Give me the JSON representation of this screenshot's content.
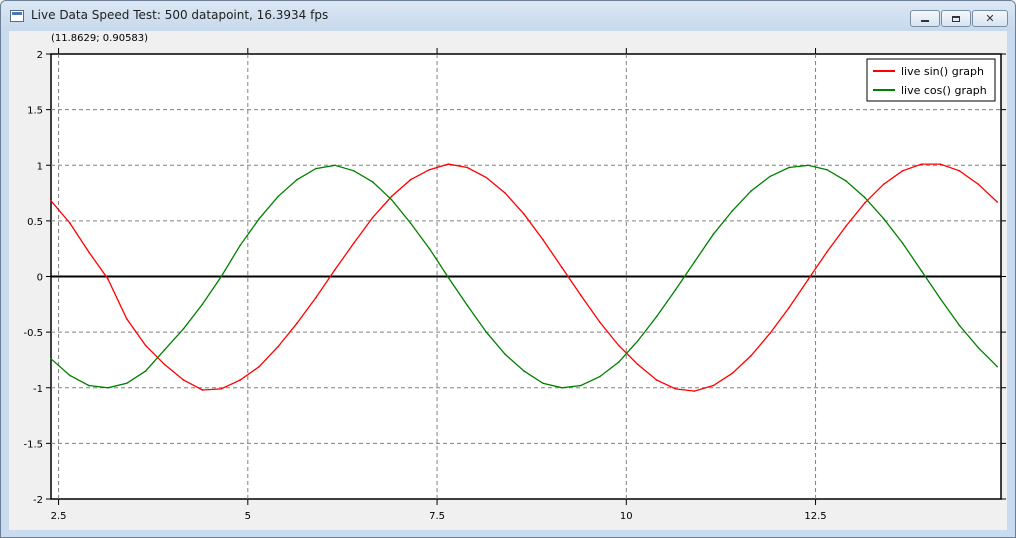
{
  "window": {
    "title": "Live Data Speed Test: 500 datapoint, 16.3934 fps"
  },
  "coord_readout": "(11.8629; 0.90583)",
  "colors": {
    "sin": "#ff0000",
    "cos": "#008000",
    "grid": "#808080",
    "zero_line": "#000000"
  },
  "chart_data": {
    "type": "line",
    "title": "",
    "xlabel": "",
    "ylabel": "",
    "xlim": [
      2.4,
      14.95
    ],
    "ylim": [
      -2,
      2
    ],
    "x_ticks": [
      2.5,
      5,
      7.5,
      10,
      12.5
    ],
    "x_tick_labels": [
      "2.5",
      "5",
      "7.5",
      "10",
      "12.5"
    ],
    "y_ticks": [
      -2,
      -1.5,
      -1,
      -0.5,
      0,
      0.5,
      1,
      1.5,
      2
    ],
    "y_tick_labels": [
      "-2",
      "-1.5",
      "-1",
      "-0.5",
      "0",
      "0.5",
      "1",
      "1.5",
      "2"
    ],
    "grid": true,
    "legend_position": "top-right",
    "x": [
      2.4,
      2.65,
      2.9,
      3.15,
      3.4,
      3.65,
      3.9,
      4.15,
      4.4,
      4.65,
      4.9,
      5.15,
      5.4,
      5.65,
      5.9,
      6.15,
      6.4,
      6.65,
      6.9,
      7.15,
      7.4,
      7.65,
      7.9,
      8.15,
      8.4,
      8.65,
      8.9,
      9.15,
      9.4,
      9.65,
      9.9,
      10.15,
      10.4,
      10.65,
      10.9,
      11.15,
      11.4,
      11.65,
      11.9,
      12.15,
      12.4,
      12.65,
      12.9,
      13.15,
      13.4,
      13.65,
      13.9,
      14.15,
      14.4,
      14.65,
      14.9
    ],
    "series": [
      {
        "name": "live sin() graph",
        "color": "#ff0000",
        "values": [
          0.68,
          0.48,
          0.22,
          -0.02,
          -0.38,
          -0.62,
          -0.79,
          -0.93,
          -1.02,
          -1.01,
          -0.93,
          -0.81,
          -0.63,
          -0.42,
          -0.19,
          0.06,
          0.3,
          0.53,
          0.72,
          0.87,
          0.96,
          1.01,
          0.98,
          0.89,
          0.75,
          0.56,
          0.33,
          0.08,
          -0.17,
          -0.41,
          -0.62,
          -0.79,
          -0.93,
          -1.01,
          -1.03,
          -0.98,
          -0.87,
          -0.71,
          -0.51,
          -0.28,
          -0.03,
          0.22,
          0.45,
          0.66,
          0.83,
          0.95,
          1.01,
          1.01,
          0.95,
          0.83,
          0.67
        ]
      },
      {
        "name": "live cos() graph",
        "color": "#008000",
        "values": [
          -0.74,
          -0.89,
          -0.98,
          -1.0,
          -0.96,
          -0.85,
          -0.66,
          -0.47,
          -0.25,
          0.0,
          0.28,
          0.52,
          0.72,
          0.87,
          0.97,
          1.0,
          0.95,
          0.85,
          0.69,
          0.48,
          0.25,
          -0.01,
          -0.26,
          -0.5,
          -0.7,
          -0.85,
          -0.96,
          -1.0,
          -0.98,
          -0.9,
          -0.77,
          -0.58,
          -0.36,
          -0.12,
          0.13,
          0.38,
          0.59,
          0.77,
          0.9,
          0.98,
          1.0,
          0.96,
          0.86,
          0.71,
          0.52,
          0.3,
          0.05,
          -0.2,
          -0.44,
          -0.64,
          -0.81
        ]
      }
    ]
  }
}
